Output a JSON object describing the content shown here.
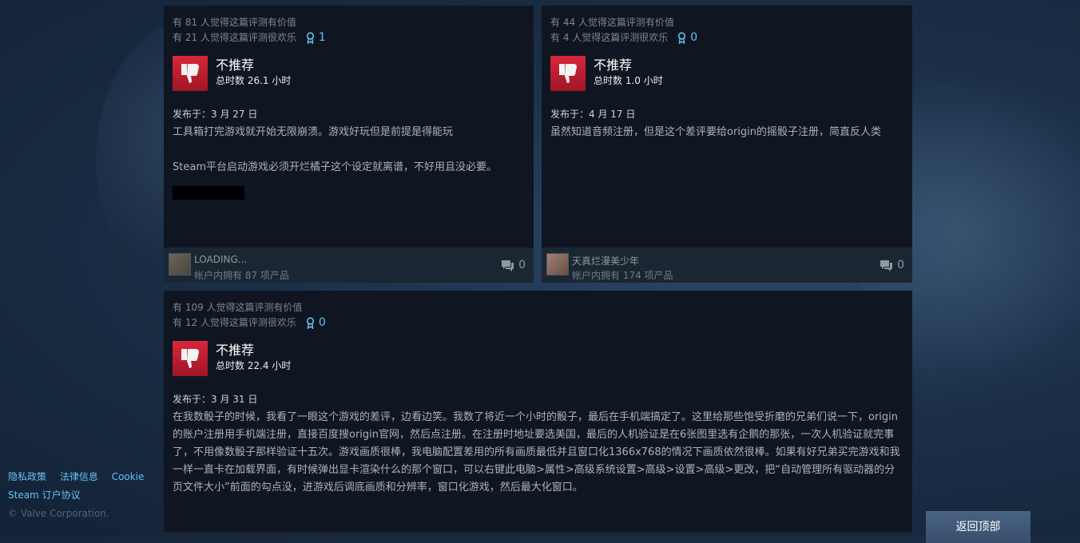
{
  "reviews": [
    {
      "helpful": "有 81 人觉得这篇评测有价值",
      "funny": "有 21 人觉得这篇评测很欢乐",
      "awards": "1",
      "recommendation": "不推荐",
      "hours": "总时数 26.1 小时",
      "posted": "发布于：3 月 27 日",
      "body": [
        "工具箱打完游戏就开始无限崩溃。游戏好玩但是前提是得能玩",
        "Steam平台启动游戏必须开烂橘子这个设定就离谱，不好用且没必要。"
      ],
      "author": "LOADING...",
      "products": "帐户内拥有 87 项产品",
      "comments": "0"
    },
    {
      "helpful": "有 44 人觉得这篇评测有价值",
      "funny": "有 4 人觉得这篇评测很欢乐",
      "awards": "0",
      "recommendation": "不推荐",
      "hours": "总时数 1.0 小时",
      "posted": "发布于：4 月 17 日",
      "body": [
        "虽然知道音频注册，但是这个差评要给origin的摇骰子注册，简直反人类"
      ],
      "author": "天真烂漫美少年",
      "products": "帐户内拥有 174 项产品",
      "comments": "0"
    },
    {
      "helpful": "有 109 人觉得这篇评测有价值",
      "funny": "有 12 人觉得这篇评测很欢乐",
      "awards": "0",
      "recommendation": "不推荐",
      "hours": "总时数 22.4 小时",
      "posted": "发布于：3 月 31 日",
      "body": [
        "在我数骰子的时候，我看了一眼这个游戏的差评，边看边笑。我数了将近一个小时的骰子，最后在手机端搞定了。这里给那些饱受折磨的兄弟们说一下，origin的账户注册用手机端注册，直接百度搜origin官网，然后点注册。在注册时地址要选美国，最后的人机验证是在6张图里选有企鹅的那张，一次人机验证就完事了，不用像数骰子那样验证十五次。游戏画质很棒，我电脑配置差用的所有画质最低并且窗口化1366x768的情况下画质依然很棒。如果有好兄弟买完游戏和我一样一直卡在加载界面，有时候弹出显卡渲染什么的那个窗口，可以右键此电脑>属性>高级系统设置>高级>设置>高级>更改，把“自动管理所有驱动器的分页文件大小”前面的勾点没，进游戏后调底画质和分辨率，窗口化游戏，然后最大化窗口。"
      ]
    }
  ],
  "footer": {
    "privacy": "隐私政策",
    "legal": "法律信息",
    "cookie": "Cookie",
    "subscriber": "Steam 订户协议",
    "copyright": "© Valve Corporation."
  },
  "back_to_top": "返回顶部",
  "icons": {
    "thumb_down": "thumbs-down-icon",
    "award": "award-icon",
    "comment": "comment-icon"
  },
  "colors": {
    "accent": "#66c0f4",
    "thumb_red": "#c1172b"
  }
}
